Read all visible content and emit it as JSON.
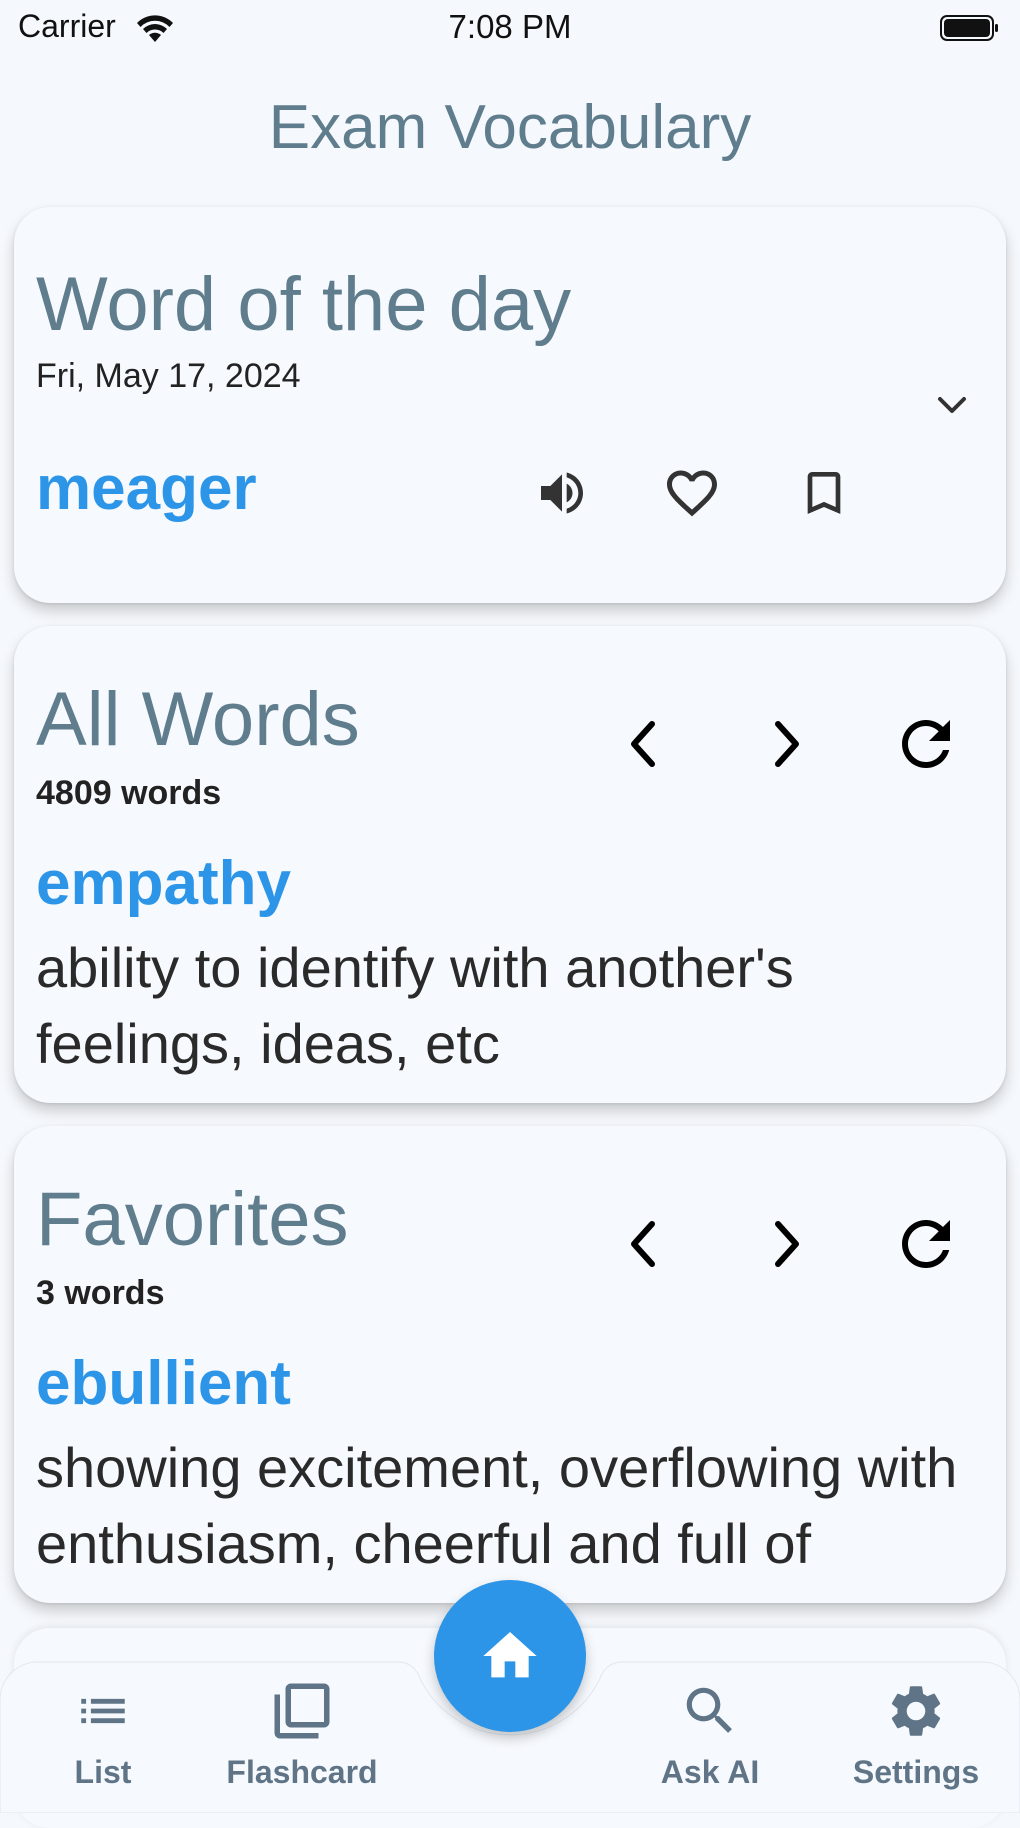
{
  "status_bar": {
    "carrier": "Carrier",
    "time": "7:08 PM"
  },
  "header": {
    "title": "Exam Vocabulary"
  },
  "word_of_day": {
    "title": "Word of the day",
    "date": "Fri, May 17, 2024",
    "word": "meager",
    "icons": [
      "chevron-down-icon",
      "speaker-icon",
      "heart-outline-icon",
      "bookmark-outline-icon"
    ]
  },
  "all_words": {
    "title": "All Words",
    "count": "4809 words",
    "word": "empathy",
    "definition": "ability to identify with another's feelings, ideas, etc",
    "icons": [
      "chevron-left-icon",
      "chevron-right-icon",
      "refresh-icon"
    ]
  },
  "favorites": {
    "title": "Favorites",
    "count": "3 words",
    "word": "ebullient",
    "definition": "showing excitement, overflowing with enthusiasm, cheerful and full of energy",
    "icons": [
      "chevron-left-icon",
      "chevron-right-icon",
      "refresh-icon"
    ]
  },
  "bottom_nav": {
    "items": [
      {
        "label": "List",
        "icon": "list-icon"
      },
      {
        "label": "Flashcard",
        "icon": "flashcard-icon"
      },
      {
        "label": "Ask AI",
        "icon": "search-icon"
      },
      {
        "label": "Settings",
        "icon": "gear-icon"
      }
    ],
    "fab_icon": "home-icon"
  },
  "colors": {
    "background": "#f5f8fc",
    "title_grey": "#5f7d8c",
    "accent_blue": "#2c95e8",
    "nav_label": "#5f7486"
  }
}
